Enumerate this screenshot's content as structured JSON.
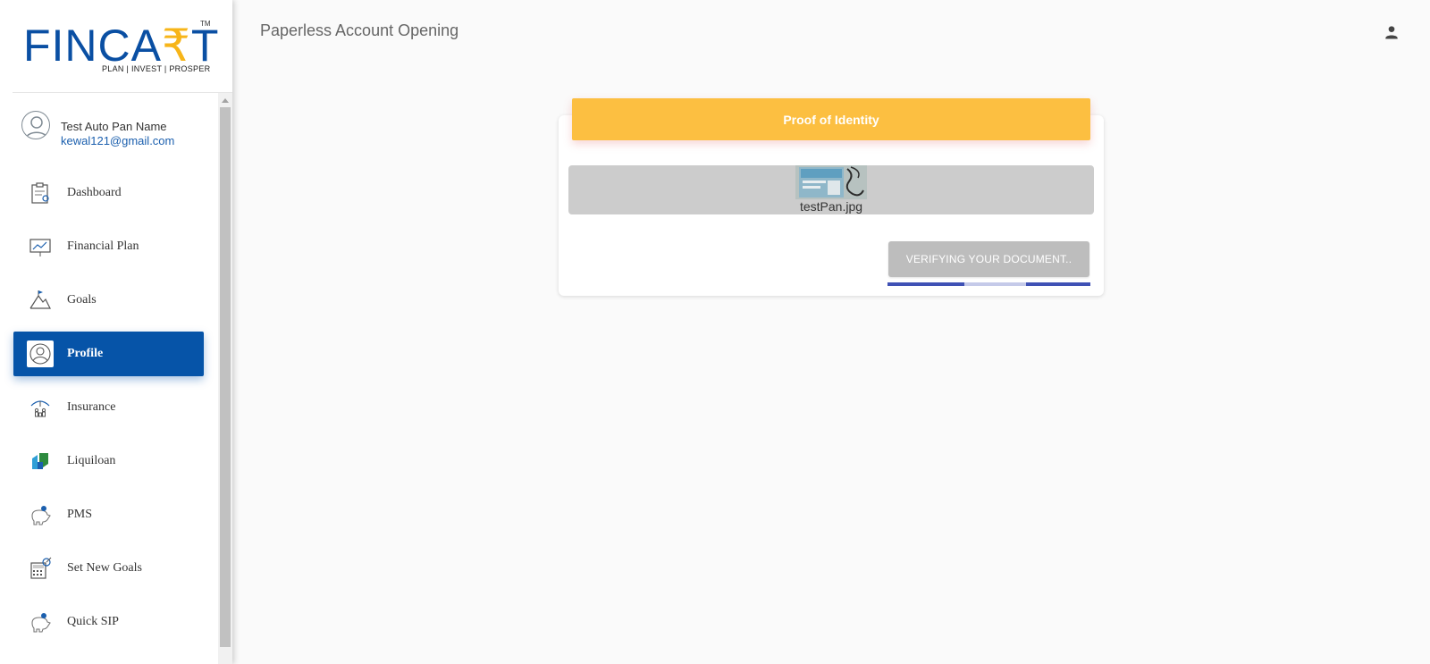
{
  "brand": {
    "logo_main": "FINCA",
    "logo_r": "₹",
    "logo_end": "T",
    "tm": "TM",
    "tagline": "PLAN | INVEST | PROSPER",
    "primary_color": "#0654a8",
    "accent_color": "#fcbf41"
  },
  "user": {
    "name": "Test Auto Pan Name",
    "email": "kewal121@gmail.com"
  },
  "nav": {
    "items": [
      {
        "label": "Dashboard",
        "icon": "clipboard-icon"
      },
      {
        "label": "Financial Plan",
        "icon": "chart-board-icon"
      },
      {
        "label": "Goals",
        "icon": "mountain-flag-icon"
      },
      {
        "label": "Profile",
        "icon": "user-profile-icon",
        "active": true
      },
      {
        "label": "Insurance",
        "icon": "umbrella-family-icon"
      },
      {
        "label": "Liquiloan",
        "icon": "liquiloan-icon"
      },
      {
        "label": "PMS",
        "icon": "piggy-bank-icon"
      },
      {
        "label": "Set New Goals",
        "icon": "calculator-target-icon"
      },
      {
        "label": "Quick SIP",
        "icon": "piggy-bank-icon"
      }
    ]
  },
  "header": {
    "title": "Paperless Account Opening",
    "account_icon": "account-icon"
  },
  "card": {
    "title": "Proof of Identity",
    "file_name": "testPan.jpg",
    "verify_button": "VERIFYING YOUR DOCUMENT.."
  }
}
